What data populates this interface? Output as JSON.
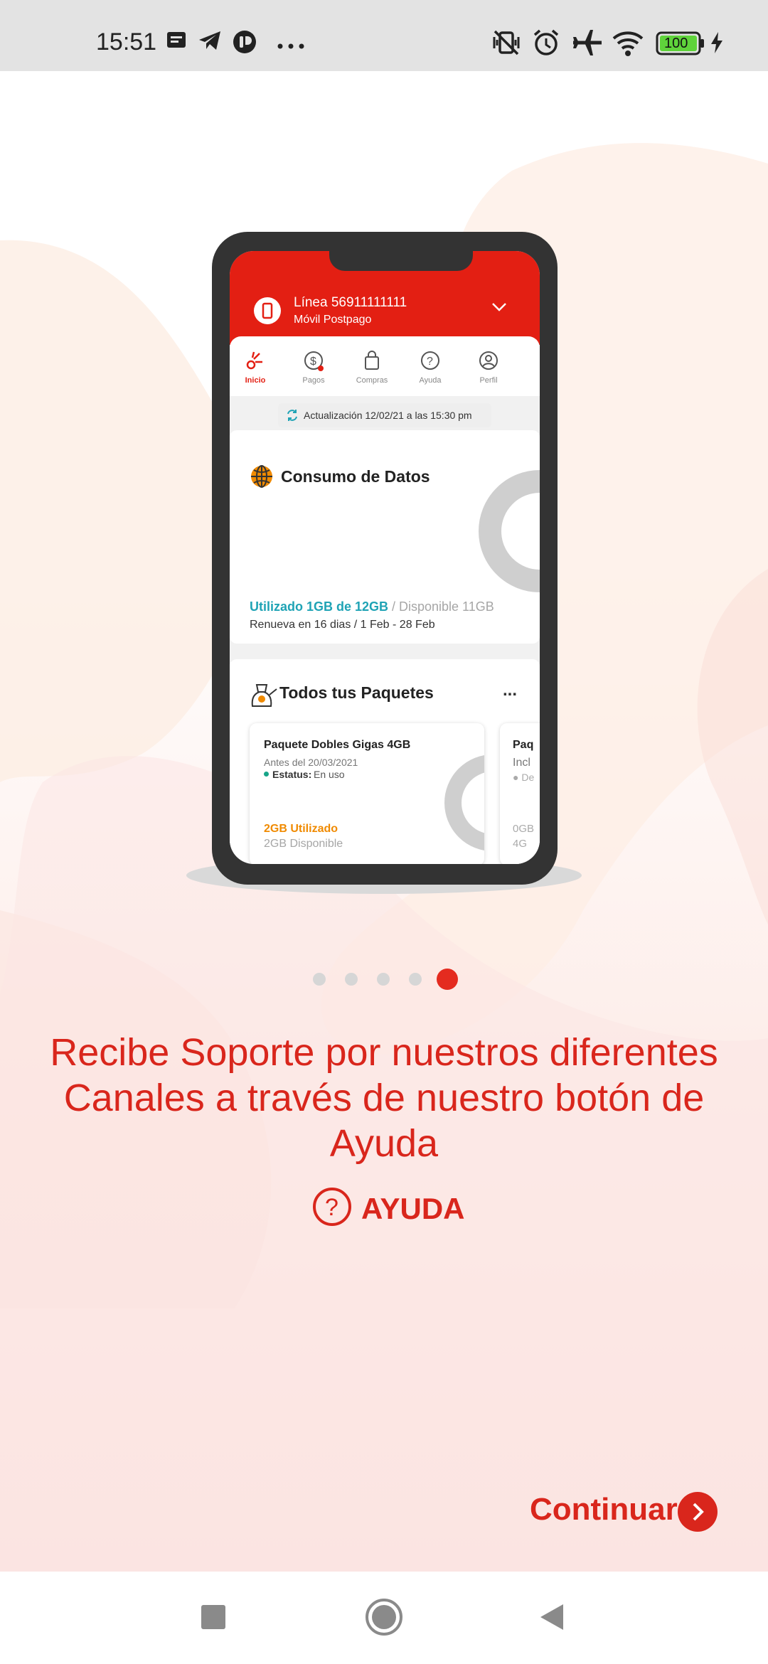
{
  "status_bar": {
    "time": "15:51",
    "battery": "100",
    "icons": [
      "message-icon",
      "telegram-icon",
      "app-icon",
      "more-icon",
      "vibrate-off-icon",
      "alarm-icon",
      "airplane-icon",
      "wifi-icon",
      "battery-icon",
      "charging-icon"
    ]
  },
  "phone_mockup": {
    "line_title": "Línea 56911111111",
    "line_subtitle": "Móvil Postpago",
    "nav": [
      {
        "label": "Inicio",
        "icon": "home-icon",
        "active": true
      },
      {
        "label": "Pagos",
        "icon": "dollar-icon",
        "active": false
      },
      {
        "label": "Compras",
        "icon": "bag-icon",
        "active": false
      },
      {
        "label": "Ayuda",
        "icon": "help-icon",
        "active": false
      },
      {
        "label": "Perfil",
        "icon": "profile-icon",
        "active": false
      }
    ],
    "update_text": "Actualización 12/02/21 a las 15:30 pm",
    "data_card": {
      "title": "Consumo de Datos",
      "used": "Utilizado 1GB de 12GB",
      "available": "/ Disponible 11GB",
      "renew": "Renueva en 16 dias / 1 Feb - 28 Feb"
    },
    "packages_card": {
      "title": "Todos tus Paquetes",
      "more": "...",
      "package": {
        "name": "Paquete Dobles Gigas 4GB",
        "before": "Antes del 20/03/2021",
        "status_label": "Estatus:",
        "status_value": "En uso",
        "used": "2GB Utilizado",
        "available": "2GB Disponible"
      },
      "package_peek": {
        "name": "Paq",
        "line2": "Incl",
        "line3": "De",
        "line4": "0GB",
        "line5": "4G"
      }
    }
  },
  "pager": {
    "count": 5,
    "active_index": 4
  },
  "headline": "Recibe Soporte por nuestros diferentes Canales a través de nuestro botón de Ayuda",
  "help_label": "AYUDA",
  "continue_label": "Continuar",
  "colors": {
    "accent": "#d9261c",
    "header_red": "#e31f13",
    "teal": "#1fa3b5",
    "orange": "#f08a00"
  }
}
